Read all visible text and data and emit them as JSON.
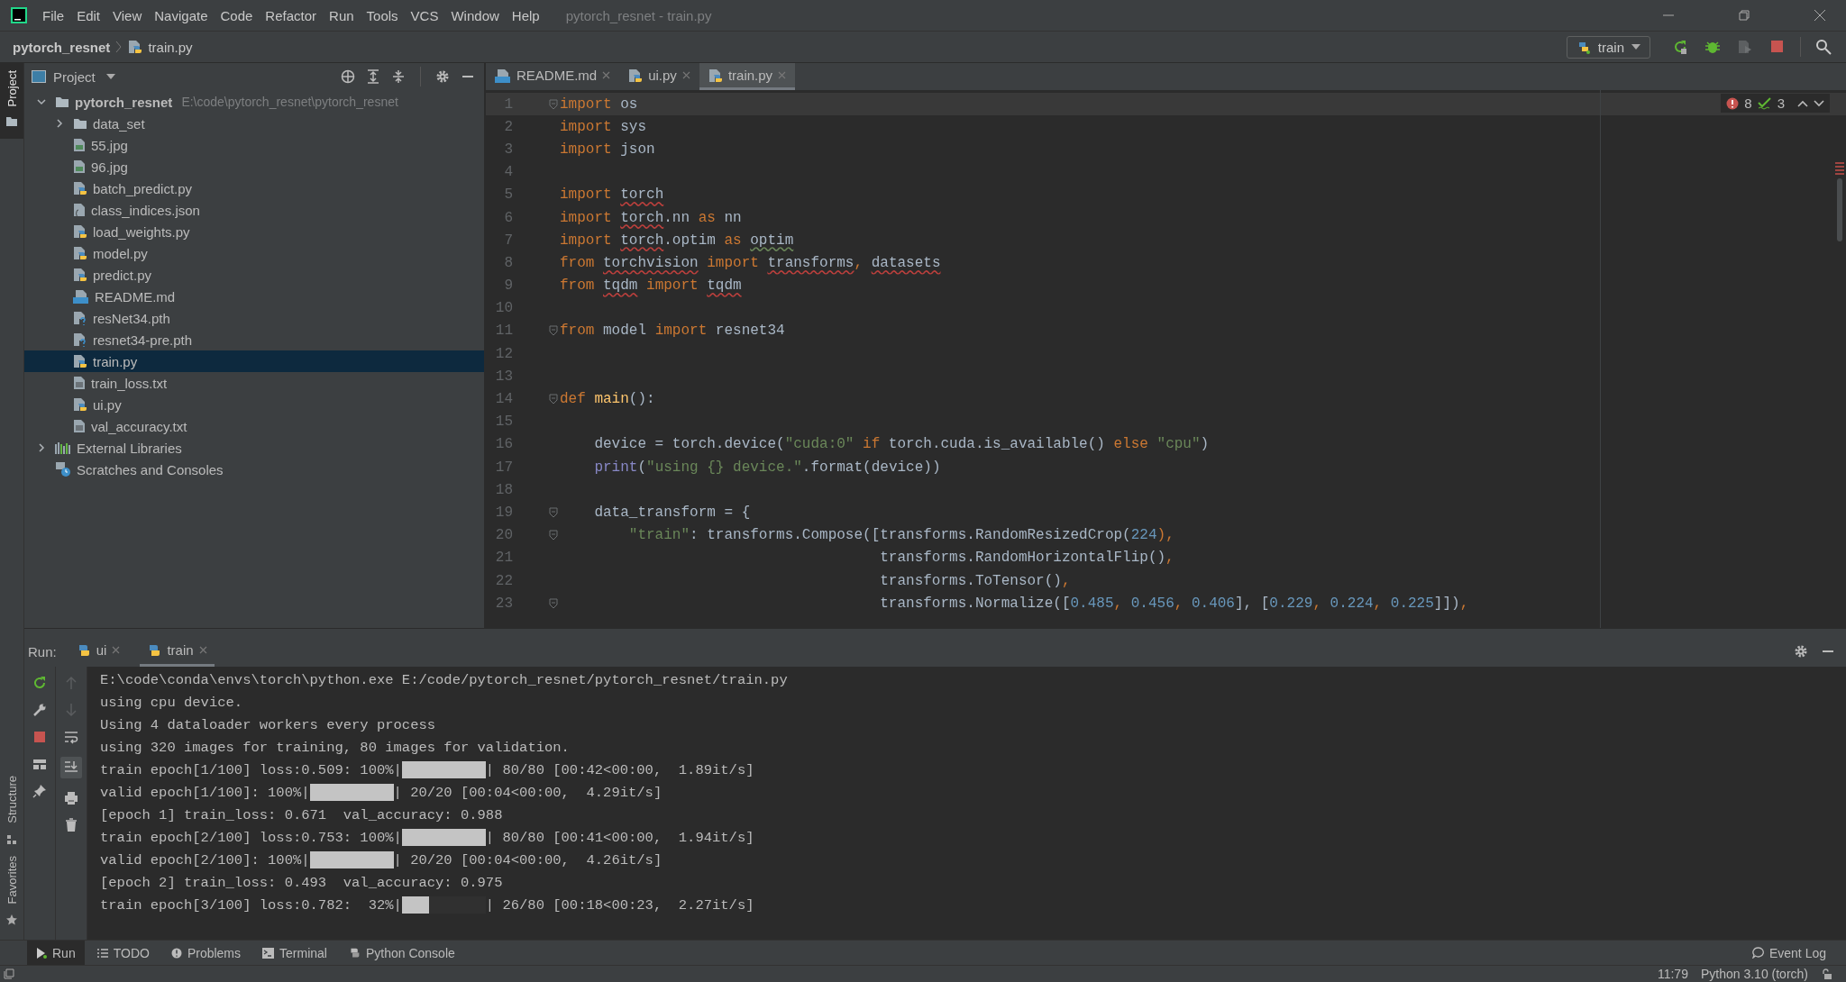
{
  "menu": [
    "File",
    "Edit",
    "View",
    "Navigate",
    "Code",
    "Refactor",
    "Run",
    "Tools",
    "VCS",
    "Window",
    "Help"
  ],
  "window_title": "pytorch_resnet - train.py",
  "breadcrumb": [
    "pytorch_resnet",
    "train.py"
  ],
  "run_config": {
    "label": "train"
  },
  "left_tabs_top": [
    {
      "label": "Project",
      "selected": true
    }
  ],
  "left_tabs_bottom": [
    {
      "label": "Structure",
      "selected": false
    },
    {
      "label": "Favorites",
      "selected": false
    }
  ],
  "project_panel": {
    "title": "Project",
    "tree": [
      {
        "name": "pytorch_resnet",
        "path": "E:\\code\\pytorch_resnet\\pytorch_resnet",
        "kind": "folder",
        "expanded": true,
        "selected": false,
        "children": [
          {
            "name": "data_set",
            "kind": "folder",
            "expanded": false,
            "selected": false
          },
          {
            "name": "55.jpg",
            "kind": "image",
            "selected": false
          },
          {
            "name": "96.jpg",
            "kind": "image",
            "selected": false
          },
          {
            "name": "batch_predict.py",
            "kind": "python",
            "selected": false
          },
          {
            "name": "class_indices.json",
            "kind": "json",
            "selected": false
          },
          {
            "name": "load_weights.py",
            "kind": "python",
            "selected": false
          },
          {
            "name": "model.py",
            "kind": "python",
            "selected": false
          },
          {
            "name": "predict.py",
            "kind": "python",
            "selected": false
          },
          {
            "name": "README.md",
            "kind": "md",
            "selected": false
          },
          {
            "name": "resNet34.pth",
            "kind": "unknown",
            "selected": false
          },
          {
            "name": "resnet34-pre.pth",
            "kind": "unknown",
            "selected": false
          },
          {
            "name": "train.py",
            "kind": "python",
            "selected": true
          },
          {
            "name": "train_loss.txt",
            "kind": "text",
            "selected": false
          },
          {
            "name": "ui.py",
            "kind": "python",
            "selected": false
          },
          {
            "name": "val_accuracy.txt",
            "kind": "text",
            "selected": false
          }
        ]
      },
      {
        "name": "External Libraries",
        "kind": "libraries",
        "expanded": false,
        "selected": false
      },
      {
        "name": "Scratches and Consoles",
        "kind": "scratches",
        "selected": false
      }
    ]
  },
  "editor_tabs": [
    {
      "label": "README.md",
      "kind": "md",
      "selected": false
    },
    {
      "label": "ui.py",
      "kind": "python",
      "selected": false
    },
    {
      "label": "train.py",
      "kind": "python",
      "selected": true
    }
  ],
  "inspections": {
    "errors": "8",
    "warnings": "3"
  },
  "code_lines": [
    {
      "number": "1",
      "fold": true,
      "current": true,
      "tokens": [
        {
          "text": "import",
          "kind": "kw"
        },
        {
          "text": " os",
          "kind": "plain"
        }
      ]
    },
    {
      "number": "2",
      "fold": false,
      "current": false,
      "tokens": [
        {
          "text": "import",
          "kind": "kw"
        },
        {
          "text": " sys",
          "kind": "plain"
        }
      ]
    },
    {
      "number": "3",
      "fold": false,
      "current": false,
      "tokens": [
        {
          "text": "import",
          "kind": "kw"
        },
        {
          "text": " json",
          "kind": "plain"
        }
      ]
    },
    {
      "number": "4",
      "fold": false,
      "current": false
    },
    {
      "number": "5",
      "fold": false,
      "current": false,
      "tokens": [
        {
          "text": "import ",
          "kind": "kw"
        },
        {
          "text": "torch",
          "kind": "err"
        }
      ]
    },
    {
      "number": "6",
      "fold": false,
      "current": false,
      "tokens": [
        {
          "text": "import ",
          "kind": "kw"
        },
        {
          "text": "torch",
          "kind": "err"
        },
        {
          "text": ".nn ",
          "kind": "plain"
        },
        {
          "text": "as",
          "kind": "kw"
        },
        {
          "text": " nn",
          "kind": "plain"
        }
      ]
    },
    {
      "number": "7",
      "fold": false,
      "current": false,
      "tokens": [
        {
          "text": "import ",
          "kind": "kw"
        },
        {
          "text": "torch",
          "kind": "err"
        },
        {
          "text": ".optim ",
          "kind": "plain"
        },
        {
          "text": "as ",
          "kind": "kw"
        },
        {
          "text": "optim",
          "kind": "weak"
        }
      ]
    },
    {
      "number": "8",
      "fold": false,
      "current": false,
      "tokens": [
        {
          "text": "from ",
          "kind": "kw"
        },
        {
          "text": "torchvision",
          "kind": "err"
        },
        {
          "text": " import ",
          "kind": "kw"
        },
        {
          "text": "transforms",
          "kind": "err"
        },
        {
          "text": ", ",
          "kind": "kw"
        },
        {
          "text": "datasets",
          "kind": "err"
        }
      ]
    },
    {
      "number": "9",
      "fold": false,
      "current": false,
      "tokens": [
        {
          "text": "from ",
          "kind": "kw"
        },
        {
          "text": "tqdm",
          "kind": "err"
        },
        {
          "text": " import ",
          "kind": "kw"
        },
        {
          "text": "tqdm",
          "kind": "err"
        }
      ]
    },
    {
      "number": "10",
      "fold": false,
      "current": false
    },
    {
      "number": "11",
      "fold": true,
      "current": false,
      "tokens": [
        {
          "text": "from",
          "kind": "kw"
        },
        {
          "text": " model ",
          "kind": "plain"
        },
        {
          "text": "import",
          "kind": "kw"
        },
        {
          "text": " resnet34",
          "kind": "plain"
        }
      ]
    },
    {
      "number": "12",
      "fold": false,
      "current": false
    },
    {
      "number": "13",
      "fold": false,
      "current": false
    },
    {
      "number": "14",
      "fold": true,
      "current": false,
      "tokens": [
        {
          "text": "def ",
          "kind": "kw"
        },
        {
          "text": "main",
          "kind": "fn"
        },
        {
          "text": "():",
          "kind": "plain"
        }
      ]
    },
    {
      "number": "15",
      "fold": false,
      "current": false
    },
    {
      "number": "16",
      "fold": false,
      "current": false,
      "tokens": [
        {
          "text": "    device = torch.device(",
          "kind": "plain"
        },
        {
          "text": "\"cuda:0\"",
          "kind": "str"
        },
        {
          "text": " if",
          "kind": "kw"
        },
        {
          "text": " torch.cuda.is_available() ",
          "kind": "plain"
        },
        {
          "text": "else ",
          "kind": "kw"
        },
        {
          "text": "\"cpu\"",
          "kind": "str"
        },
        {
          "text": ")",
          "kind": "plain"
        }
      ]
    },
    {
      "number": "17",
      "fold": false,
      "current": false,
      "tokens": [
        {
          "text": "    print",
          "kind": "builtin"
        },
        {
          "text": "(",
          "kind": "plain"
        },
        {
          "text": "\"using {} device.\"",
          "kind": "str"
        },
        {
          "text": ".format(device))",
          "kind": "plain"
        }
      ]
    },
    {
      "number": "18",
      "fold": false,
      "current": false
    },
    {
      "number": "19",
      "fold": true,
      "current": false,
      "tokens": [
        {
          "text": "    data_transform = {",
          "kind": "plain"
        }
      ]
    },
    {
      "number": "20",
      "fold": true,
      "current": false,
      "tokens": [
        {
          "text": "        \"train\"",
          "kind": "str"
        },
        {
          "text": ": transforms.Compose([transforms.RandomResizedCrop(",
          "kind": "plain"
        },
        {
          "text": "224",
          "kind": "num"
        },
        {
          "text": "),",
          "kind": "kw"
        }
      ]
    },
    {
      "number": "21",
      "fold": false,
      "current": false,
      "tokens": [
        {
          "text": "                                     transforms.RandomHorizontalFlip()",
          "kind": "plain"
        },
        {
          "text": ",",
          "kind": "kw"
        }
      ]
    },
    {
      "number": "22",
      "fold": false,
      "current": false,
      "tokens": [
        {
          "text": "                                     transforms.ToTensor()",
          "kind": "plain"
        },
        {
          "text": ",",
          "kind": "kw"
        }
      ]
    },
    {
      "number": "23",
      "fold": true,
      "current": false,
      "tokens": [
        {
          "text": "                                     transforms.Normalize([",
          "kind": "plain"
        },
        {
          "text": "0.485",
          "kind": "num"
        },
        {
          "text": ", ",
          "kind": "kw"
        },
        {
          "text": "0.456",
          "kind": "num"
        },
        {
          "text": ", ",
          "kind": "kw"
        },
        {
          "text": "0.406",
          "kind": "num"
        },
        {
          "text": "], [",
          "kind": "plain"
        },
        {
          "text": "0.229",
          "kind": "num"
        },
        {
          "text": ", ",
          "kind": "kw"
        },
        {
          "text": "0.224",
          "kind": "num"
        },
        {
          "text": ", ",
          "kind": "kw"
        },
        {
          "text": "0.225",
          "kind": "num"
        },
        {
          "text": "]])",
          "kind": "plain"
        },
        {
          "text": ",",
          "kind": "kw"
        }
      ]
    }
  ],
  "run_panel": {
    "label": "Run:",
    "tabs": [
      {
        "label": "ui",
        "selected": false
      },
      {
        "label": "train",
        "selected": true
      }
    ],
    "console": [
      {
        "kind": "text",
        "text": "E:\\code\\conda\\envs\\torch\\python.exe E:/code/pytorch_resnet/pytorch_resnet/train.py"
      },
      {
        "kind": "text",
        "text": "using cpu device."
      },
      {
        "kind": "text",
        "text": "Using 4 dataloader workers every process"
      },
      {
        "kind": "text",
        "text": "using 320 images for training, 80 images for validation."
      },
      {
        "kind": "progress",
        "prefix": "train epoch[1/100] loss:0.509: 100%|",
        "level": 1,
        "suffix": "| 80/80 [00:42<00:00,  1.89it/s]"
      },
      {
        "kind": "progress",
        "prefix": "valid epoch[1/100]: 100%|",
        "level": 1,
        "suffix": "| 20/20 [00:04<00:00,  4.29it/s]"
      },
      {
        "kind": "text",
        "text": "[epoch 1] train_loss: 0.671  val_accuracy: 0.988"
      },
      {
        "kind": "progress",
        "prefix": "train epoch[2/100] loss:0.753: 100%|",
        "level": 1,
        "suffix": "| 80/80 [00:41<00:00,  1.94it/s]"
      },
      {
        "kind": "progress",
        "prefix": "valid epoch[2/100]: 100%|",
        "level": 1,
        "suffix": "| 20/20 [00:04<00:00,  4.26it/s]"
      },
      {
        "kind": "text",
        "text": "[epoch 2] train_loss: 0.493  val_accuracy: 0.975"
      },
      {
        "kind": "progress",
        "prefix": "train epoch[3/100] loss:0.782:  32%|",
        "level": 0.32,
        "suffix": "| 26/80 [00:18<00:23,  2.27it/s]"
      }
    ]
  },
  "bottom_tabs": [
    {
      "label": "Run",
      "kind": "run",
      "selected": true
    },
    {
      "label": "TODO",
      "kind": "todo",
      "selected": false
    },
    {
      "label": "Problems",
      "kind": "problems",
      "selected": false
    },
    {
      "label": "Terminal",
      "kind": "terminal",
      "selected": false
    },
    {
      "label": "Python Console",
      "kind": "console",
      "selected": false
    }
  ],
  "event_log": "Event Log",
  "status": {
    "position": "11:79",
    "interpreter": "Python 3.10 (torch)"
  }
}
